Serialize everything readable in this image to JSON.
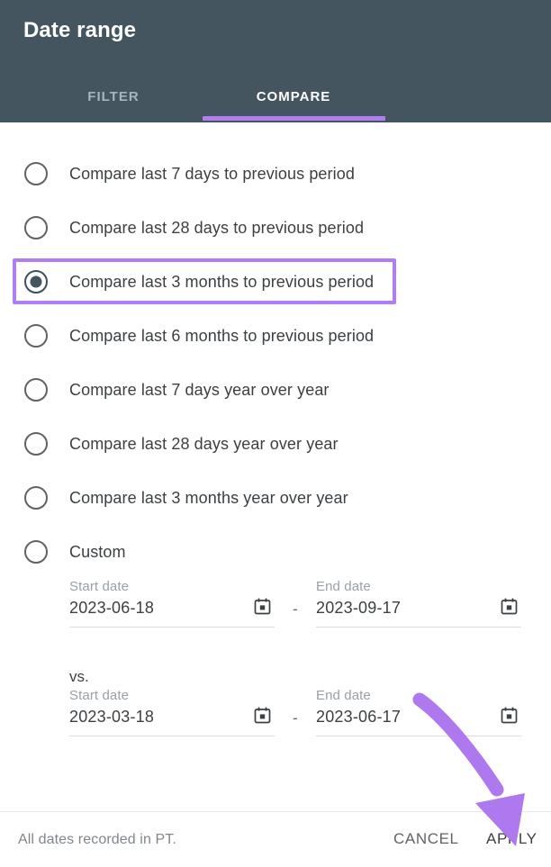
{
  "header": {
    "title": "Date range",
    "background_color": "#45555f",
    "tabs": [
      {
        "label": "FILTER",
        "active": false
      },
      {
        "label": "COMPARE",
        "active": true
      }
    ],
    "active_tab_accent": "#b07ef0"
  },
  "options": [
    {
      "label": "Compare last 7 days to previous period",
      "selected": false
    },
    {
      "label": "Compare last 28 days to previous period",
      "selected": false
    },
    {
      "label": "Compare last 3 months to previous period",
      "selected": true
    },
    {
      "label": "Compare last 6 months to previous period",
      "selected": false
    },
    {
      "label": "Compare last 7 days year over year",
      "selected": false
    },
    {
      "label": "Compare last 28 days year over year",
      "selected": false
    },
    {
      "label": "Compare last 3 months year over year",
      "selected": false
    },
    {
      "label": "Custom",
      "selected": false
    }
  ],
  "custom": {
    "vs_label": "vs.",
    "separator": "-",
    "primary": {
      "start": {
        "caption": "Start date",
        "value": "2023-06-18"
      },
      "end": {
        "caption": "End date",
        "value": "2023-09-17"
      }
    },
    "comparison": {
      "start": {
        "caption": "Start date",
        "value": "2023-03-18"
      },
      "end": {
        "caption": "End date",
        "value": "2023-06-17"
      }
    },
    "calendar_icon": "calendar-icon"
  },
  "footer": {
    "note": "All dates recorded in PT.",
    "cancel_label": "CANCEL",
    "apply_label": "APPLY"
  },
  "annotations": {
    "highlight_color": "#b07ef0",
    "arrow_color": "#ae78ee",
    "highlight_target": "Compare last 3 months to previous period",
    "arrow_target": "APPLY"
  }
}
